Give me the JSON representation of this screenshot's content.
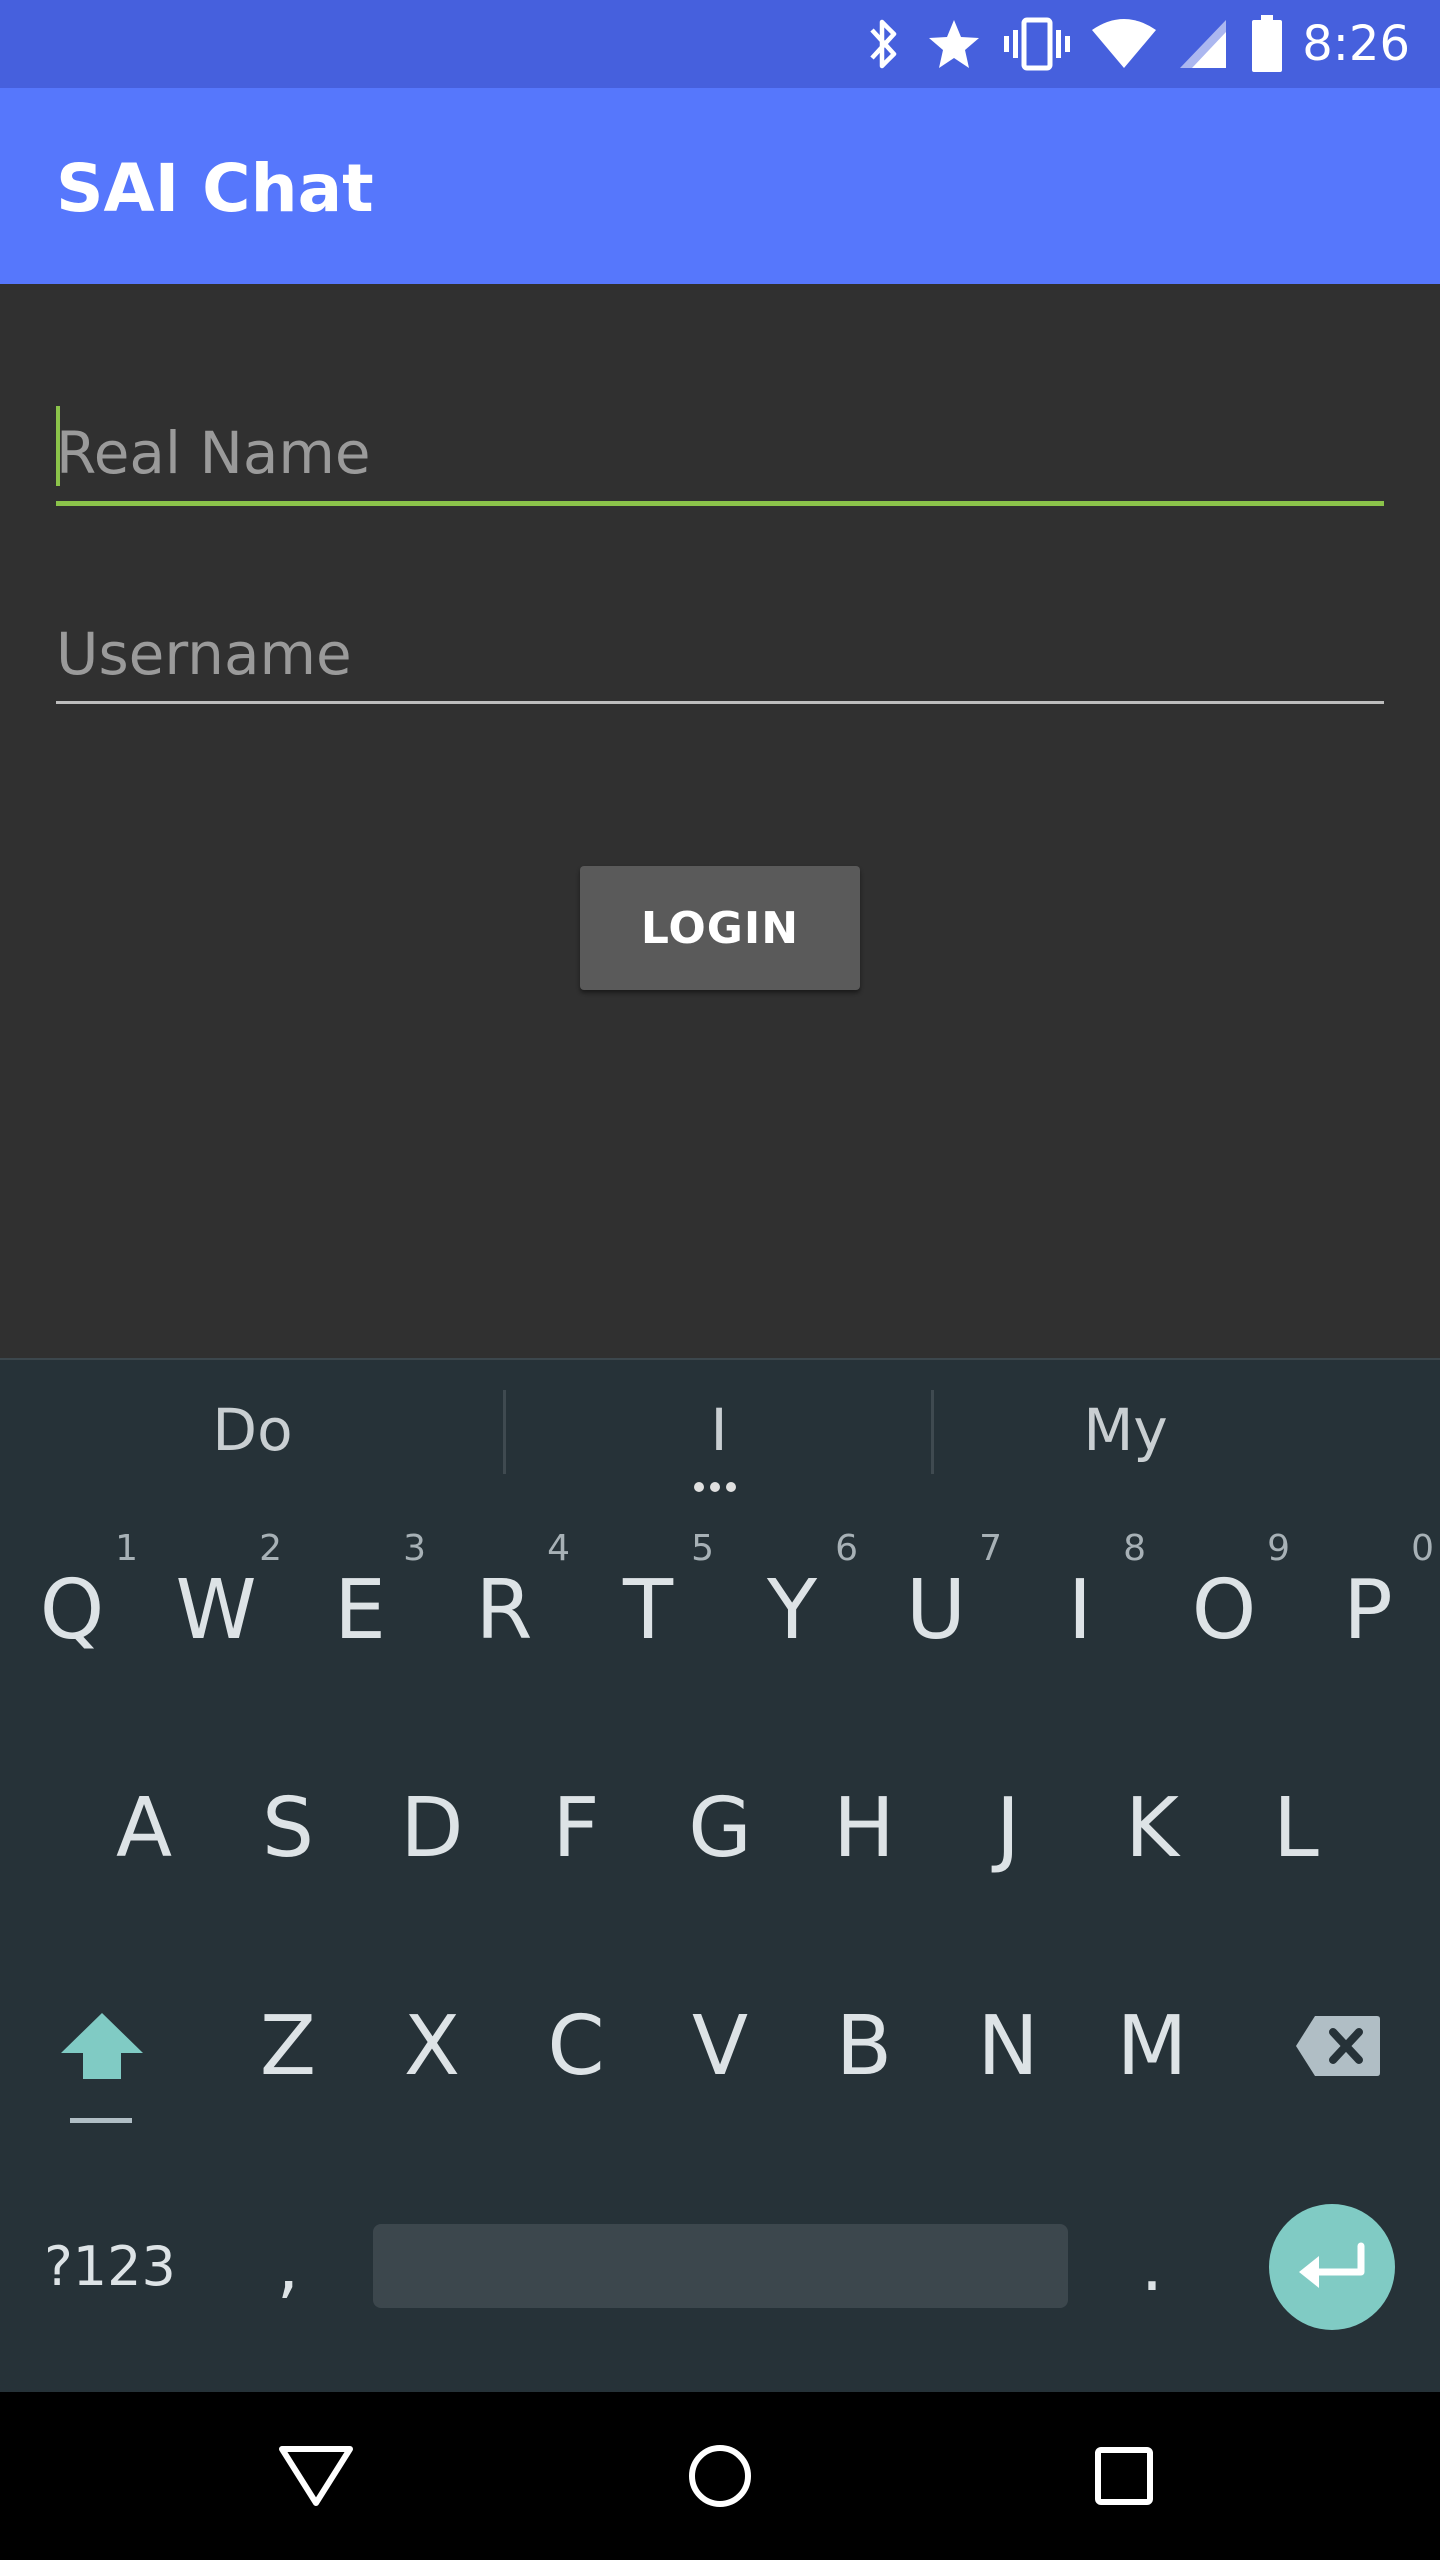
{
  "status_bar": {
    "time": "8:26",
    "icons": [
      "bluetooth-icon",
      "star-icon",
      "vibrate-icon",
      "wifi-icon",
      "cell-signal-icon",
      "battery-icon"
    ],
    "background": "#4660dd"
  },
  "app_bar": {
    "title": "SAI Chat",
    "background": "#5677fc"
  },
  "form": {
    "real_name": {
      "placeholder": "Real Name",
      "value": "",
      "focused": true
    },
    "username": {
      "placeholder": "Username",
      "value": ""
    },
    "login_label": "LOGIN",
    "accent": "#8bc34a"
  },
  "keyboard": {
    "suggestions": [
      "Do",
      "I",
      "My"
    ],
    "row1": [
      {
        "label": "Q",
        "hint": "1"
      },
      {
        "label": "W",
        "hint": "2"
      },
      {
        "label": "E",
        "hint": "3"
      },
      {
        "label": "R",
        "hint": "4"
      },
      {
        "label": "T",
        "hint": "5"
      },
      {
        "label": "Y",
        "hint": "6"
      },
      {
        "label": "U",
        "hint": "7"
      },
      {
        "label": "I",
        "hint": "8"
      },
      {
        "label": "O",
        "hint": "9"
      },
      {
        "label": "P",
        "hint": "0"
      }
    ],
    "row2": [
      "A",
      "S",
      "D",
      "F",
      "G",
      "H",
      "J",
      "K",
      "L"
    ],
    "row3": [
      "Z",
      "X",
      "C",
      "V",
      "B",
      "N",
      "M"
    ],
    "symbols_label": "?123",
    "comma": ",",
    "period": ".",
    "shift_icon": "shift-icon",
    "backspace_icon": "backspace-icon",
    "enter_icon": "enter-icon",
    "enter_color": "#80cbc4"
  },
  "nav_bar": {
    "icons": [
      "back-icon",
      "home-icon",
      "recents-icon"
    ]
  }
}
